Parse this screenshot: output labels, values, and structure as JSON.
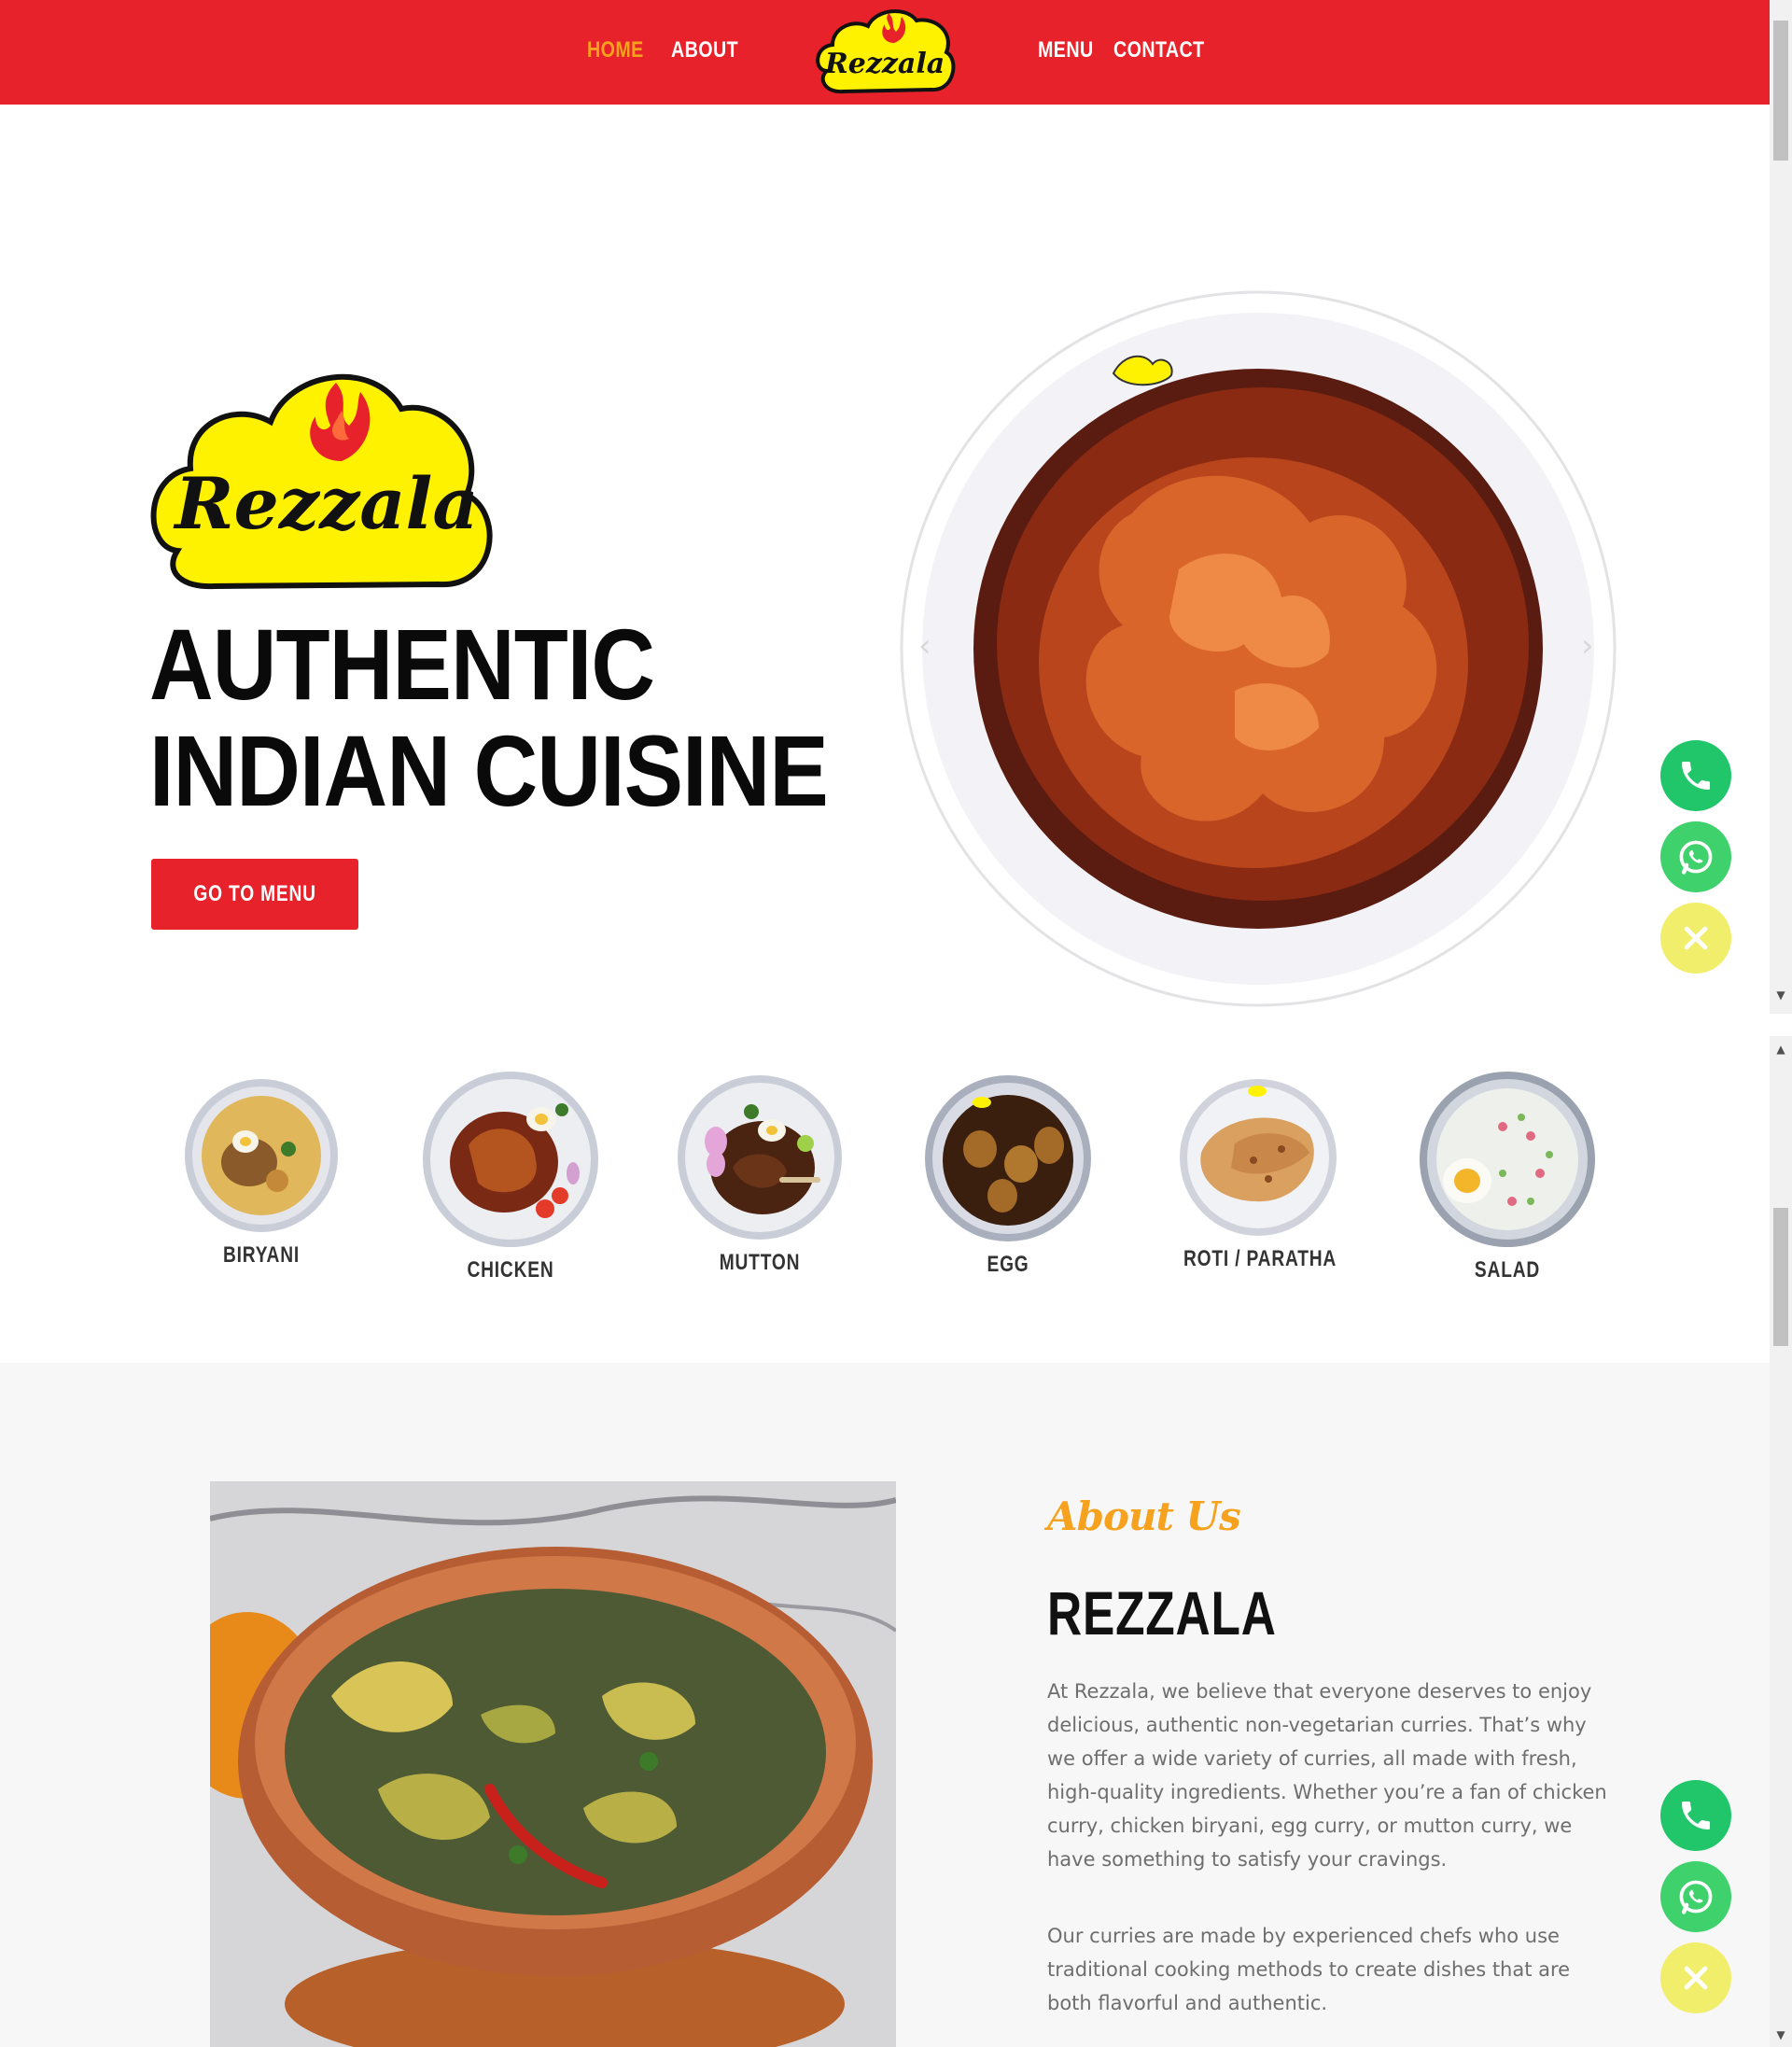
{
  "header": {
    "nav": [
      {
        "label": "HOME",
        "active": true
      },
      {
        "label": "ABOUT",
        "active": false
      },
      {
        "label": "MENU",
        "active": false
      },
      {
        "label": "CONTACT",
        "active": false
      }
    ],
    "logo_text": "Rezzala",
    "colors": {
      "bar": "#e8222a",
      "active_link": "#f6a21e",
      "logo_fill": "#fff200"
    }
  },
  "hero": {
    "logo_text": "Rezzala",
    "title_line1": "AUTHENTIC",
    "title_line2": "INDIAN CUISINE",
    "cta_label": "GO TO MENU",
    "carousel": {
      "prev_icon": "chevron-left-icon",
      "next_icon": "chevron-right-icon"
    }
  },
  "floating_contact": {
    "buttons": [
      "phone-icon",
      "whatsapp-icon",
      "close-icon"
    ],
    "colors": {
      "call": "#21c66a",
      "whatsapp": "#3fd16b",
      "close": "#f1ee6b"
    }
  },
  "categories": [
    {
      "label": "BIRYANI"
    },
    {
      "label": "CHICKEN"
    },
    {
      "label": "MUTTON"
    },
    {
      "label": "EGG"
    },
    {
      "label": "ROTI / PARATHA"
    },
    {
      "label": "SALAD"
    }
  ],
  "about": {
    "kicker": "About Us",
    "heading": "REZZALA",
    "paragraph1": "At Rezzala, we believe that everyone deserves to enjoy delicious, authentic non-vegetarian curries. That’s why we offer a wide variety of curries, all made with fresh, high-quality ingredients. Whether you’re a fan of chicken curry, chicken biryani, egg curry, or mutton curry, we have something to satisfy your cravings.",
    "paragraph2": "Our curries are made by experienced chefs who use traditional cooking methods to create dishes that are both flavorful and authentic."
  }
}
